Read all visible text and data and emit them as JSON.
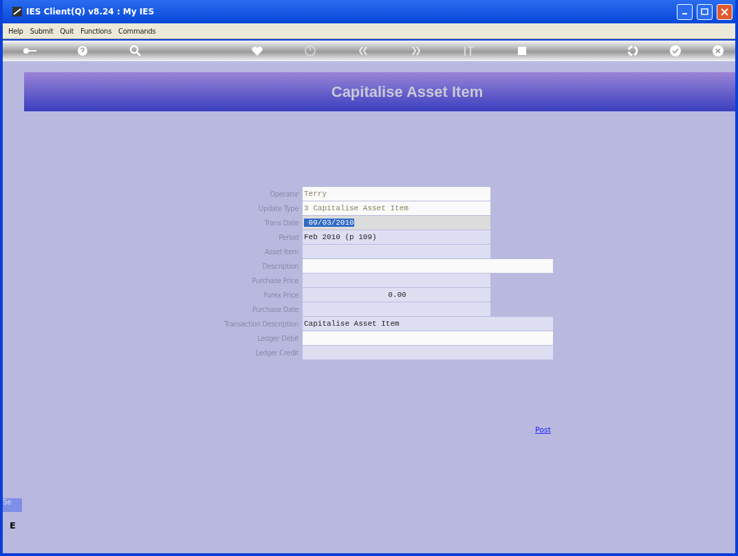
{
  "window": {
    "title": "IES Client(Q) v8.24 : My IES"
  },
  "menu": [
    "Help",
    "Submit",
    "Quit",
    "Functions",
    "Commands"
  ],
  "toolbar": [
    {
      "kind": "key"
    },
    {
      "kind": "help"
    },
    {
      "kind": "search"
    },
    {
      "kind": "gap"
    },
    {
      "kind": "heart"
    },
    {
      "kind": "clock"
    },
    {
      "kind": "back"
    },
    {
      "kind": "forward"
    },
    {
      "kind": "text"
    },
    {
      "kind": "stop"
    },
    {
      "kind": "gap"
    },
    {
      "kind": "recycle"
    },
    {
      "kind": "check"
    },
    {
      "kind": "close"
    }
  ],
  "header": {
    "title": "Capitalise Asset Item"
  },
  "form": [
    {
      "label": "Operator",
      "value": "Terry",
      "kind": "text",
      "light": true,
      "wide": false,
      "focused": false,
      "greyed": true
    },
    {
      "label": "Update Type",
      "value": "3 Capitalise Asset Item",
      "kind": "text",
      "light": true,
      "wide": false,
      "focused": false,
      "greyed": true
    },
    {
      "label": "Trans Date",
      "value": " 09/03/2010",
      "kind": "text",
      "light": false,
      "wide": false,
      "focused": true,
      "greyed": false
    },
    {
      "label": "Period",
      "value": "Feb 2010 (p 109)",
      "kind": "text",
      "light": false,
      "wide": false,
      "focused": false,
      "greyed": false
    },
    {
      "label": "Asset Item",
      "kind": "text",
      "light": false,
      "wide": false,
      "focused": false
    },
    {
      "label": "Description",
      "kind": "text",
      "light": true,
      "wide": true,
      "focused": false
    },
    {
      "label": "Purchase Price",
      "kind": "text",
      "light": false,
      "wide": false,
      "focused": false
    },
    {
      "label": "Forex Price",
      "value": "0.00",
      "kind": "number",
      "light": false,
      "wide": false,
      "focused": false,
      "greyed": false
    },
    {
      "label": "Purchase Date",
      "kind": "text",
      "light": false,
      "wide": false,
      "focused": false
    },
    {
      "label": "Transaction Description",
      "value": "Capitalise Asset Item",
      "kind": "text",
      "light": false,
      "wide": true,
      "focused": false,
      "greyed": false
    },
    {
      "label": "Ledger Debit",
      "kind": "text",
      "light": true,
      "wide": true,
      "focused": false
    },
    {
      "label": "Ledger Credit",
      "kind": "text",
      "light": false,
      "wide": true,
      "focused": false
    }
  ],
  "post_link": "Post",
  "side_tab": {
    "label": "Se",
    "glyph": "E"
  }
}
